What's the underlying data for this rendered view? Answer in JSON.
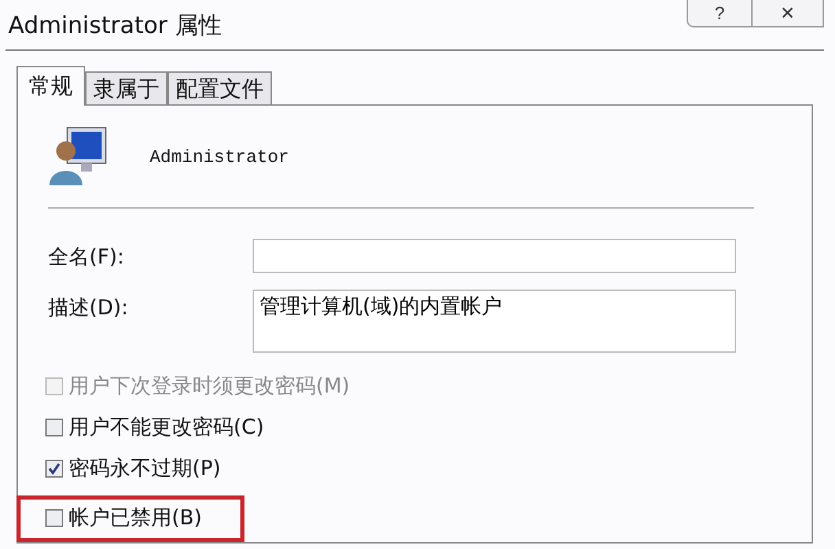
{
  "window": {
    "title": "Administrator 属性"
  },
  "title_buttons": [
    {
      "kind": "help",
      "label": "?"
    },
    {
      "kind": "close",
      "label": "✕"
    }
  ],
  "tabs": [
    {
      "label": "常规",
      "selected": true
    },
    {
      "label": "隶属于",
      "selected": false
    },
    {
      "label": "配置文件",
      "selected": false
    }
  ],
  "user": {
    "name": "Administrator"
  },
  "fields": [
    {
      "label": "全名(F):",
      "kind": "line"
    },
    {
      "label": "描述(D):",
      "value": "管理计算机(域)的内置帐户",
      "kind": "area"
    }
  ],
  "options": [
    {
      "label": "用户下次登录时须更改密码(M)",
      "checked": false,
      "disabled": true,
      "highlighted": false
    },
    {
      "label": "用户不能更改密码(C)",
      "checked": false,
      "disabled": false,
      "highlighted": false
    },
    {
      "label": "密码永不过期(P)",
      "checked": true,
      "disabled": false,
      "highlighted": false
    },
    {
      "label": "帐户已禁用(B)",
      "checked": false,
      "disabled": false,
      "highlighted": true
    }
  ]
}
